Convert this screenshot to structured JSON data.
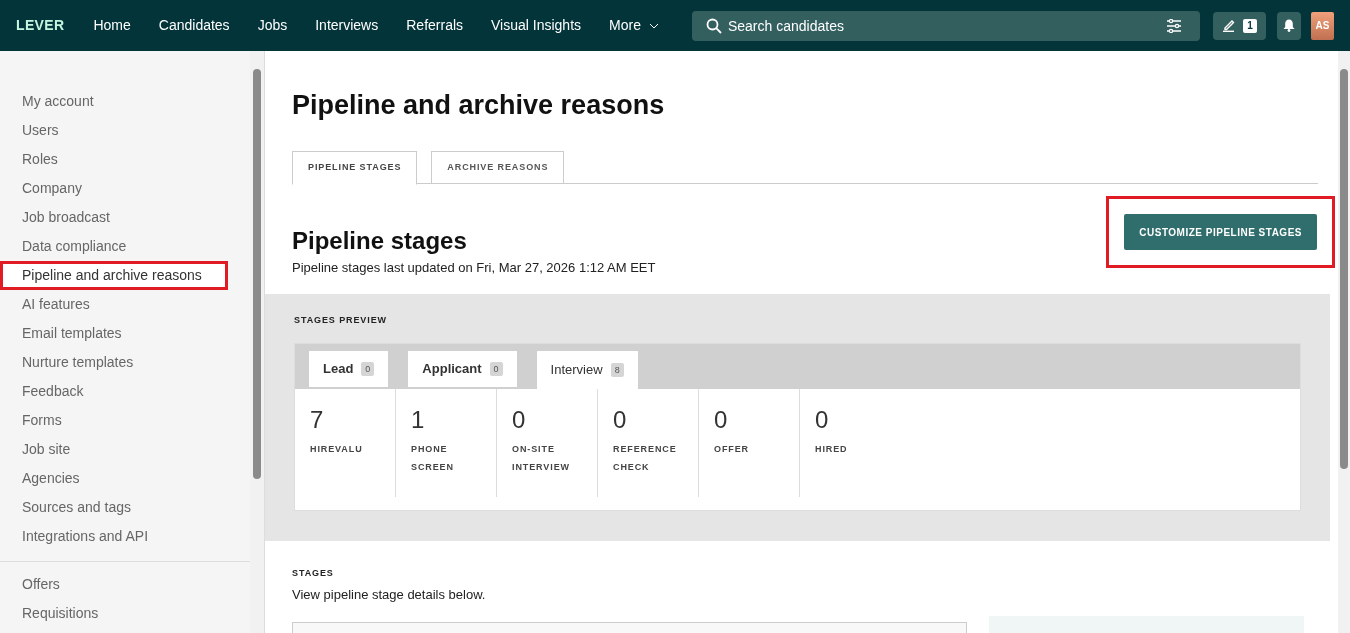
{
  "topbar": {
    "logo": "LEVER",
    "nav": [
      {
        "label": "Home",
        "kind": "link"
      },
      {
        "label": "Candidates",
        "kind": "link"
      },
      {
        "label": "Jobs",
        "kind": "link"
      },
      {
        "label": "Interviews",
        "kind": "link"
      },
      {
        "label": "Referrals",
        "kind": "link"
      },
      {
        "label": "Visual Insights",
        "kind": "link"
      },
      {
        "label": "More",
        "kind": "menu"
      }
    ],
    "search": {
      "placeholder": "Search candidates"
    },
    "drafts_count": "1",
    "avatar": "AS"
  },
  "sidebar": {
    "groups": [
      [
        {
          "label": "My account",
          "selected": false,
          "highlighted": false
        },
        {
          "label": "Users",
          "selected": false,
          "highlighted": false
        },
        {
          "label": "Roles",
          "selected": false,
          "highlighted": false
        },
        {
          "label": "Company",
          "selected": false,
          "highlighted": false
        },
        {
          "label": "Job broadcast",
          "selected": false,
          "highlighted": false
        },
        {
          "label": "Data compliance",
          "selected": false,
          "highlighted": false
        },
        {
          "label": "Pipeline and archive reasons",
          "selected": true,
          "highlighted": true
        },
        {
          "label": "AI features",
          "selected": false,
          "highlighted": false
        },
        {
          "label": "Email templates",
          "selected": false,
          "highlighted": false
        },
        {
          "label": "Nurture templates",
          "selected": false,
          "highlighted": false
        },
        {
          "label": "Feedback",
          "selected": false,
          "highlighted": false
        },
        {
          "label": "Forms",
          "selected": false,
          "highlighted": false
        },
        {
          "label": "Job site",
          "selected": false,
          "highlighted": false
        },
        {
          "label": "Agencies",
          "selected": false,
          "highlighted": false
        },
        {
          "label": "Sources and tags",
          "selected": false,
          "highlighted": false
        },
        {
          "label": "Integrations and API",
          "selected": false,
          "highlighted": false
        }
      ],
      [
        {
          "label": "Offers",
          "selected": false,
          "highlighted": false
        },
        {
          "label": "Requisitions",
          "selected": false,
          "highlighted": false
        }
      ]
    ]
  },
  "main": {
    "title": "Pipeline and archive reasons",
    "tabs": [
      {
        "label": "PIPELINE STAGES",
        "selected": true
      },
      {
        "label": "ARCHIVE REASONS",
        "selected": false
      }
    ],
    "section_title": "Pipeline stages",
    "action": {
      "label": "CUSTOMIZE PIPELINE STAGES",
      "highlighted": true
    },
    "updated": "Pipeline stages last updated on Fri, Mar 27, 2026 1:12 AM EET",
    "preview": {
      "heading": "STAGES PREVIEW",
      "tabs": [
        {
          "label": "Lead",
          "count": "0",
          "selected": false
        },
        {
          "label": "Applicant",
          "count": "0",
          "selected": false
        },
        {
          "label": "Interview",
          "count": "8",
          "selected": true
        }
      ],
      "stages": [
        {
          "count": "7",
          "name": "HIREVALU"
        },
        {
          "count": "1",
          "name": "PHONE SCREEN"
        },
        {
          "count": "0",
          "name": "ON-SITE INTERVIEW"
        },
        {
          "count": "0",
          "name": "REFERENCE CHECK"
        },
        {
          "count": "0",
          "name": "OFFER"
        },
        {
          "count": "0",
          "name": "HIRED"
        }
      ]
    },
    "stages": {
      "heading": "STAGES",
      "description": "View pipeline stage details below."
    }
  }
}
